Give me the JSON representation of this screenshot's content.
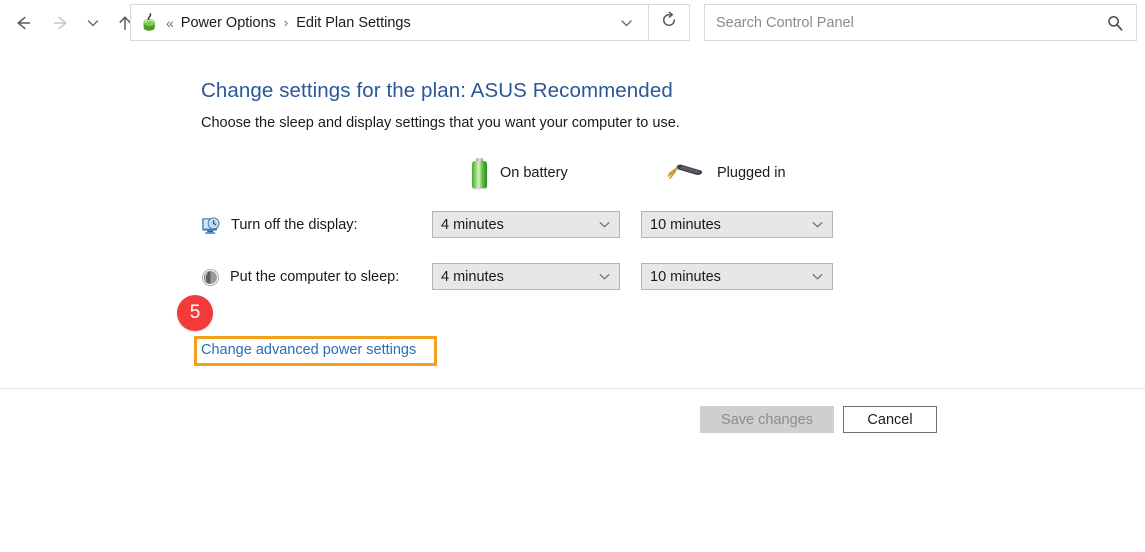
{
  "window": {
    "nav": {
      "back_icon": "arrow-left-icon",
      "back_label": "Back",
      "forward_icon": "arrow-right-icon",
      "forward_label": "Forward",
      "forward_disabled": true,
      "recent_icon": "chevron-down-icon",
      "recent_label": "Recent locations",
      "up_icon": "arrow-up-icon",
      "up_label": "Up one level"
    },
    "address_bar": {
      "icon": "power-options-battery-icon",
      "overflow_separator": "«",
      "crumb_separator": "›",
      "crumbs": [
        "Power Options",
        "Edit Plan Settings"
      ],
      "dropdown_icon": "chevron-down-icon"
    },
    "refresh": {
      "icon": "refresh-icon",
      "label": "Refresh"
    },
    "search": {
      "placeholder": "Search Control Panel",
      "value": "",
      "icon": "search-icon"
    }
  },
  "main": {
    "title": "Change settings for the plan: ASUS Recommended",
    "subtitle": "Choose the sleep and display settings that you want your computer to use.",
    "columns": [
      {
        "id": "on-battery",
        "label": "On battery",
        "icon": "battery-icon"
      },
      {
        "id": "plugged-in",
        "label": "Plugged in",
        "icon": "power-plug-icon"
      }
    ],
    "rows": [
      {
        "id": "turn-off-display",
        "icon": "display-clock-icon",
        "label": "Turn off the display:",
        "on_battery": "4 minutes",
        "plugged_in": "10 minutes"
      },
      {
        "id": "put-computer-to-sleep",
        "icon": "sleep-moon-icon",
        "label": "Put the computer to sleep:",
        "on_battery": "4 minutes",
        "plugged_in": "10 minutes"
      }
    ],
    "combo_arrow_icon": "chevron-down-icon",
    "advanced_link": "Change advanced power settings",
    "annotation": {
      "number": "5",
      "badge_color": "#f23a3a",
      "highlight_color": "#f2a01e"
    }
  },
  "footer": {
    "save_label": "Save changes",
    "save_disabled": true,
    "cancel_label": "Cancel"
  },
  "theme": {
    "title_blue": "#2b5797",
    "link_blue": "#2b6cb8",
    "combo_bg": "#e7e7e7",
    "combo_border": "#b4b4b4",
    "divider": "#e3e3e3"
  }
}
